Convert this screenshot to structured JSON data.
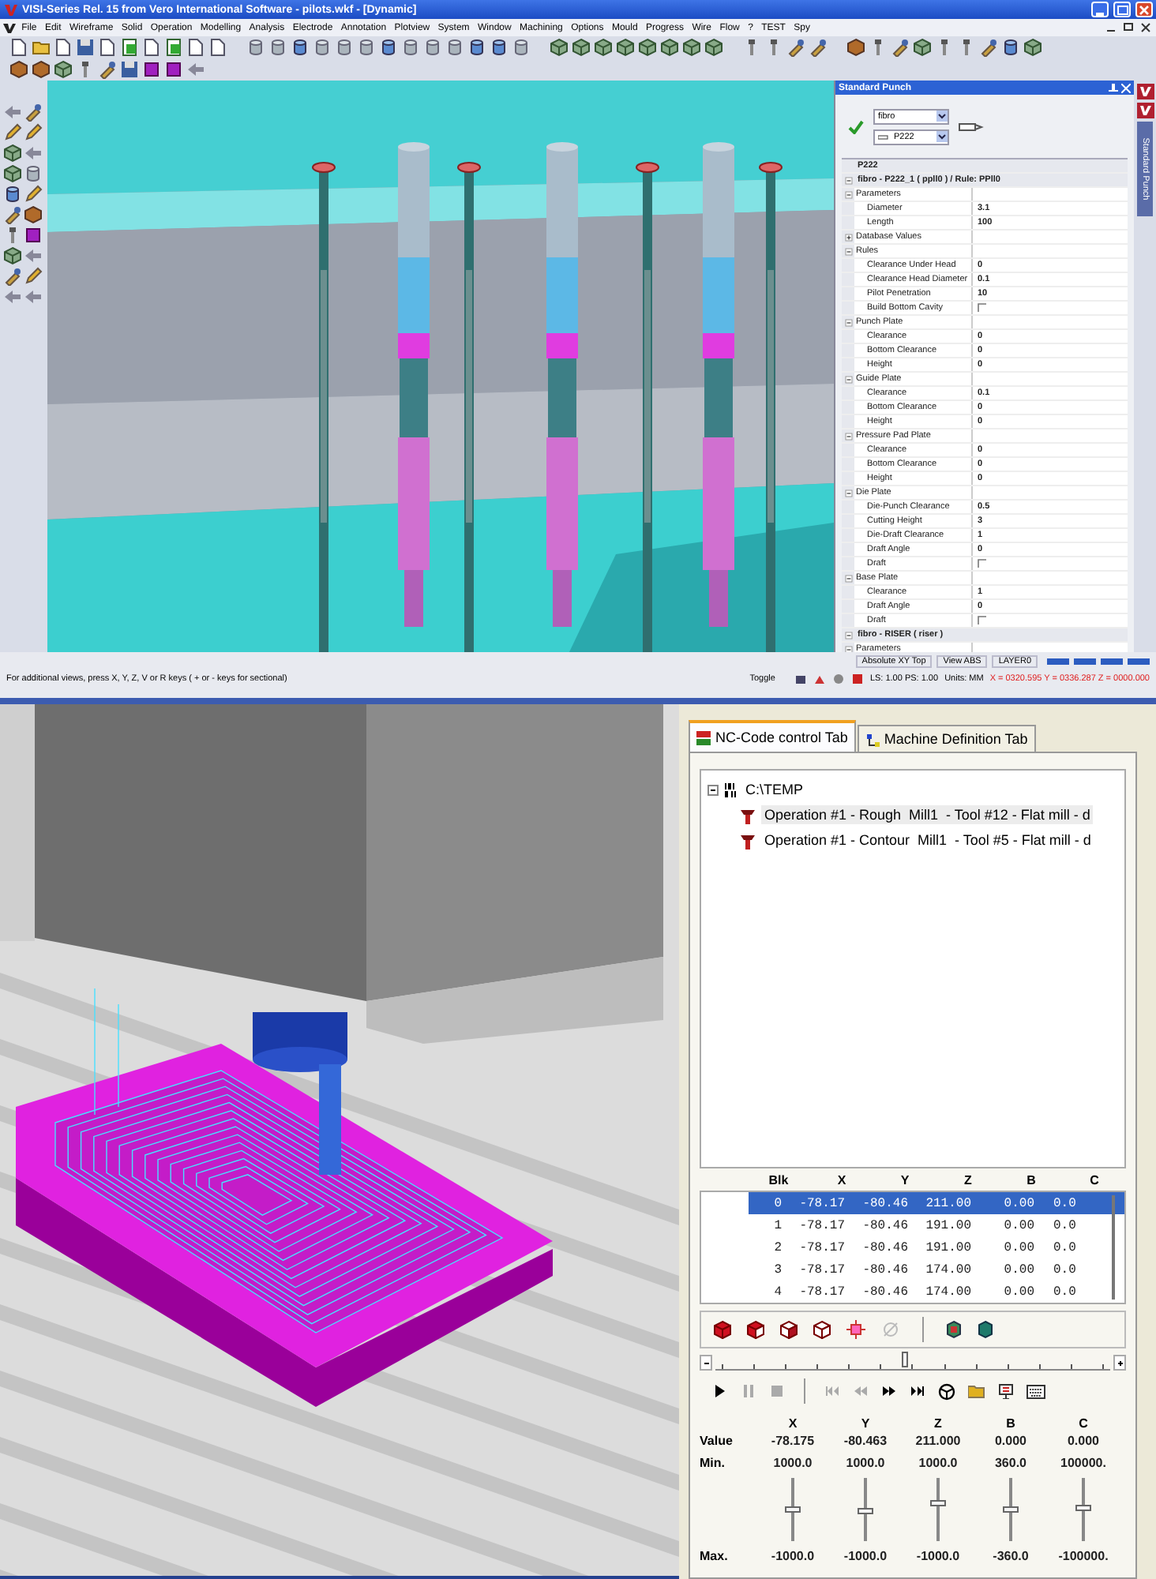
{
  "window": {
    "title": "VISI-Series Rel. 15 from Vero International Software - pilots.wkf - [Dynamic]"
  },
  "menu": [
    "File",
    "Edit",
    "Wireframe",
    "Solid",
    "Operation",
    "Modelling",
    "Analysis",
    "Electrode",
    "Annotation",
    "Plotview",
    "System",
    "Window",
    "Machining",
    "Options",
    "Mould",
    "Progress",
    "Wire",
    "Flow",
    "?",
    "TEST",
    "Spy"
  ],
  "property_panel": {
    "title": "Standard Punch",
    "side_tab": "Standard Punch",
    "dropdowns": [
      {
        "value": "fibro"
      },
      {
        "value": "P222"
      }
    ],
    "grid_title": "P222",
    "sections": [
      {
        "label": "fibro - P222_1 ( ppll0 ) / Rule: PPll0",
        "expanded": true,
        "categories": [
          {
            "label": "Parameters",
            "expanded": true,
            "rows": [
              {
                "kind": "value",
                "label": "Diameter",
                "value": "3.1"
              },
              {
                "kind": "value",
                "label": "Length",
                "value": "100"
              }
            ]
          },
          {
            "label": "Database Values",
            "expanded": false
          },
          {
            "label": "Rules",
            "expanded": true,
            "rows": [
              {
                "kind": "value",
                "label": "Clearance Under Head",
                "value": "0"
              },
              {
                "kind": "value",
                "label": "Clearance Head Diameter",
                "value": "0.1"
              },
              {
                "kind": "value",
                "label": "Pilot Penetration",
                "value": "10"
              },
              {
                "kind": "checkbox",
                "label": "Build Bottom Cavity",
                "checked": false
              }
            ]
          },
          {
            "label": "Punch Plate",
            "expanded": true,
            "rows": [
              {
                "kind": "value",
                "label": "Clearance",
                "value": "0"
              },
              {
                "kind": "value",
                "label": "Bottom Clearance",
                "value": "0"
              },
              {
                "kind": "value",
                "label": "Height",
                "value": "0"
              }
            ]
          },
          {
            "label": "Guide Plate",
            "expanded": true,
            "rows": [
              {
                "kind": "value",
                "label": "Clearance",
                "value": "0.1"
              },
              {
                "kind": "value",
                "label": "Bottom Clearance",
                "value": "0"
              },
              {
                "kind": "value",
                "label": "Height",
                "value": "0"
              }
            ]
          },
          {
            "label": "Pressure Pad Plate",
            "expanded": true,
            "rows": [
              {
                "kind": "value",
                "label": "Clearance",
                "value": "0"
              },
              {
                "kind": "value",
                "label": "Bottom Clearance",
                "value": "0"
              },
              {
                "kind": "value",
                "label": "Height",
                "value": "0"
              }
            ]
          },
          {
            "label": "Die Plate",
            "expanded": true,
            "rows": [
              {
                "kind": "value",
                "label": "Die-Punch Clearance",
                "value": "0.5"
              },
              {
                "kind": "value",
                "label": "Cutting Height",
                "value": "3"
              },
              {
                "kind": "value",
                "label": "Die-Draft Clearance",
                "value": "1"
              },
              {
                "kind": "value",
                "label": "Draft Angle",
                "value": "0"
              },
              {
                "kind": "checkbox",
                "label": "Draft",
                "checked": false
              }
            ]
          },
          {
            "label": "Base Plate",
            "expanded": true,
            "rows": [
              {
                "kind": "value",
                "label": "Clearance",
                "value": "1"
              },
              {
                "kind": "value",
                "label": "Draft Angle",
                "value": "0"
              },
              {
                "kind": "checkbox",
                "label": "Draft",
                "checked": false
              }
            ]
          }
        ]
      },
      {
        "label": "fibro - RISER ( riser )",
        "expanded": true,
        "categories": [
          {
            "label": "Parameters",
            "expanded": true
          }
        ]
      }
    ]
  },
  "status_bar": {
    "view_mode": "Absolute XY Top",
    "view": "View ABS",
    "layer": "LAYER0",
    "hint": "For additional views, press X, Y, Z, V or R keys ( + or - keys for sectional)",
    "toggle": "Toggle",
    "scale": "LS: 1.00 PS: 1.00",
    "units": "Units: MM",
    "coordinates": "X = 0320.595 Y = 0336.287 Z = 0000.000"
  },
  "tabs": [
    {
      "label": "NC-Code control Tab",
      "selected": true
    },
    {
      "label": "Machine Definition Tab",
      "selected": false
    }
  ],
  "nc_tree": {
    "label": "C:\\TEMP",
    "expanded": true,
    "children": [
      {
        "label": "Operation #1 - Rough  Mill1  - Tool #12 - Flat mill - d",
        "selected": true
      },
      {
        "label": "Operation #1 - Contour  Mill1  - Tool #5 - Flat mill - d",
        "selected": false
      }
    ]
  },
  "blocks": {
    "columns": [
      "Blk",
      "X",
      "Y",
      "Z",
      "B",
      "C"
    ],
    "rows": [
      {
        "cells": [
          "0",
          "-78.17",
          "-80.46",
          "211.00",
          "0.00",
          "0.0"
        ],
        "selected": true
      },
      {
        "cells": [
          "1",
          "-78.17",
          "-80.46",
          "191.00",
          "0.00",
          "0.0"
        ],
        "selected": false
      },
      {
        "cells": [
          "2",
          "-78.17",
          "-80.46",
          "191.00",
          "0.00",
          "0.0"
        ],
        "selected": false
      },
      {
        "cells": [
          "3",
          "-78.17",
          "-80.46",
          "174.00",
          "0.00",
          "0.0"
        ],
        "selected": false
      },
      {
        "cells": [
          "4",
          "-78.17",
          "-80.46",
          "174.00",
          "0.00",
          "0.0"
        ],
        "selected": false
      }
    ]
  },
  "position_slider": {
    "level": 0.48
  },
  "playback": [
    {
      "kind": "play",
      "disabled": false
    },
    {
      "kind": "pause",
      "disabled": true
    },
    {
      "kind": "stop",
      "disabled": true
    },
    {
      "kind": "first",
      "disabled": true
    },
    {
      "kind": "back",
      "disabled": true
    },
    {
      "kind": "forward",
      "disabled": false
    },
    {
      "kind": "last",
      "disabled": false
    }
  ],
  "axes": {
    "row_labels": {
      "value": "Value",
      "min": "Min.",
      "max": "Max."
    },
    "items": [
      {
        "name": "X",
        "value": "-78.175",
        "min": "1000.0",
        "max": "-1000.0",
        "level": 0.5
      },
      {
        "name": "Y",
        "value": "-80.463",
        "min": "1000.0",
        "max": "-1000.0",
        "level": 0.48
      },
      {
        "name": "Z",
        "value": "211.000",
        "min": "1000.0",
        "max": "-1000.0",
        "level": 0.6
      },
      {
        "name": "B",
        "value": "0.000",
        "min": "360.0",
        "max": "-360.0",
        "level": 0.5
      },
      {
        "name": "C",
        "value": "0.000",
        "min": "100000.",
        "max": "-100000.",
        "level": 0.52
      }
    ]
  }
}
